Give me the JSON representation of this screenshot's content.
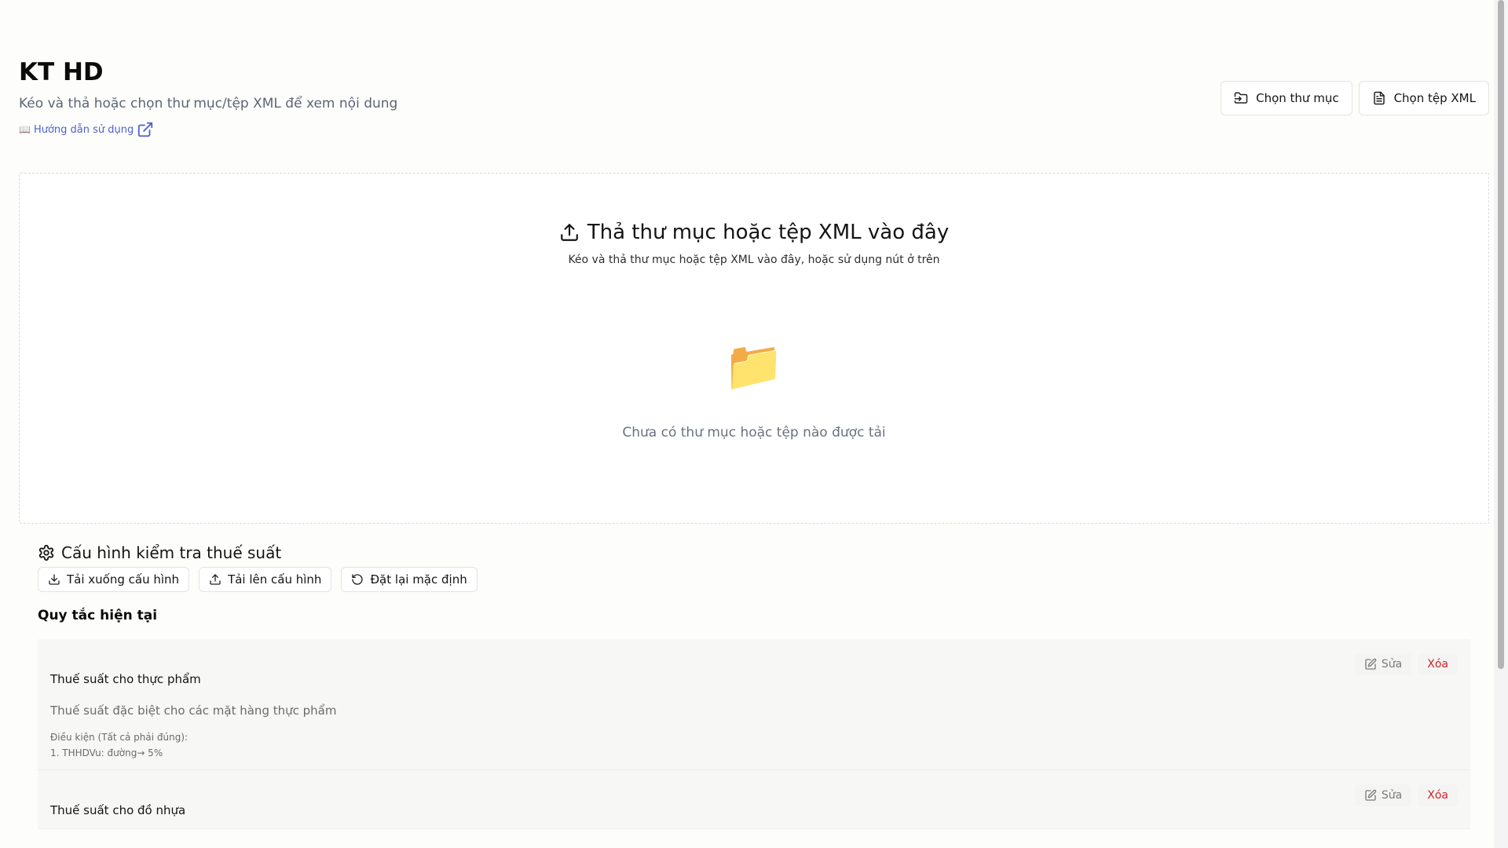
{
  "header": {
    "title": "KT HD",
    "subtitle": "Kéo và thả hoặc chọn thư mục/tệp XML để xem nội dung",
    "help_link": "Hướng dẫn sử dụng",
    "help_book_icon": "📖"
  },
  "actions": {
    "choose_folder": "Chọn thư mục",
    "choose_xml": "Chọn tệp XML"
  },
  "dropzone": {
    "title": "Thả thư mục hoặc tệp XML vào đây",
    "subtitle": "Kéo và thả thư mục hoặc tệp XML vào đây, hoặc sử dụng nút ở trên",
    "folder_icon": "📁",
    "empty_text": "Chưa có thư mục hoặc tệp nào được tải"
  },
  "config": {
    "title": "Cấu hình kiểm tra thuế suất",
    "download": "Tải xuống cấu hình",
    "upload": "Tải lên cấu hình",
    "reset": "Đặt lại mặc định",
    "rules_heading": "Quy tắc hiện tại"
  },
  "rules": [
    {
      "name": "Thuế suất cho thực phẩm",
      "description": "Thuế suất đặc biệt cho các mặt hàng thực phẩm",
      "conditions_title": "Điều kiện (Tất cả phải đúng):",
      "condition_1": "1. THHDVu: đường→ 5%",
      "edit": "Sửa",
      "delete": "Xóa"
    },
    {
      "name": "Thuế suất cho đồ nhựa",
      "edit": "Sửa",
      "delete": "Xóa"
    }
  ],
  "icons": {
    "upload": "upload-icon",
    "folder": "folder-icon",
    "file": "file-icon",
    "gear": "gear-icon",
    "download": "download-icon",
    "reset": "reset-icon",
    "edit": "edit-icon",
    "external": "external-link-icon"
  },
  "colors": {
    "link": "#4d61d6",
    "delete": "#d4202a",
    "muted": "#6b6b6b"
  }
}
